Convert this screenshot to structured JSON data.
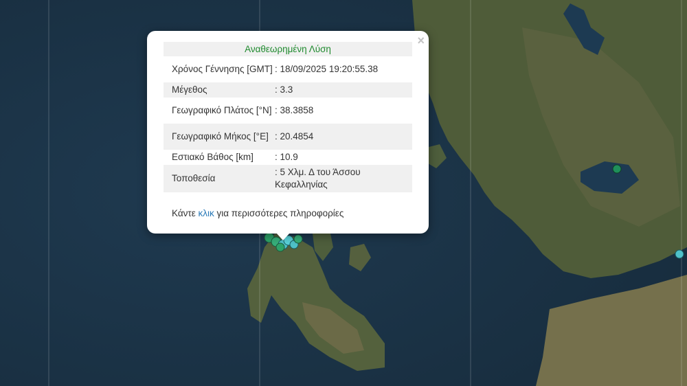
{
  "popup": {
    "title": "Αναθεωρημένη Λύση",
    "close_label": "×",
    "rows": [
      {
        "label": "Χρόνος Γέννησης [GMT]",
        "value": ": 18/09/2025 19:20:55.38"
      },
      {
        "label": "Μέγεθος",
        "value": ": 3.3"
      },
      {
        "label": "Γεωγραφικό Πλάτος [°N]",
        "value": ": 38.3858"
      },
      {
        "label": "Γεωγραφικό Μήκος [°E]",
        "value": ": 20.4854"
      },
      {
        "label": "Εστιακό Βάθος [km]",
        "value": ": 10.9"
      },
      {
        "label": "Τοποθεσία",
        "value": ": 5 Χλμ. Δ του Άσσου Κεφαλληνίας"
      }
    ],
    "more_prefix": "Κάντε ",
    "more_link": "κλικ",
    "more_suffix": " για περισσότερες πληροφορίες",
    "title_color": "#1f8a2e",
    "link_color": "#2a7ab8"
  },
  "map": {
    "sea_color": "#1c3346",
    "land_color": "#4a5a36",
    "marker_colors": [
      "#2ea36a",
      "#4fc1c9",
      "#1f8f5a"
    ]
  }
}
